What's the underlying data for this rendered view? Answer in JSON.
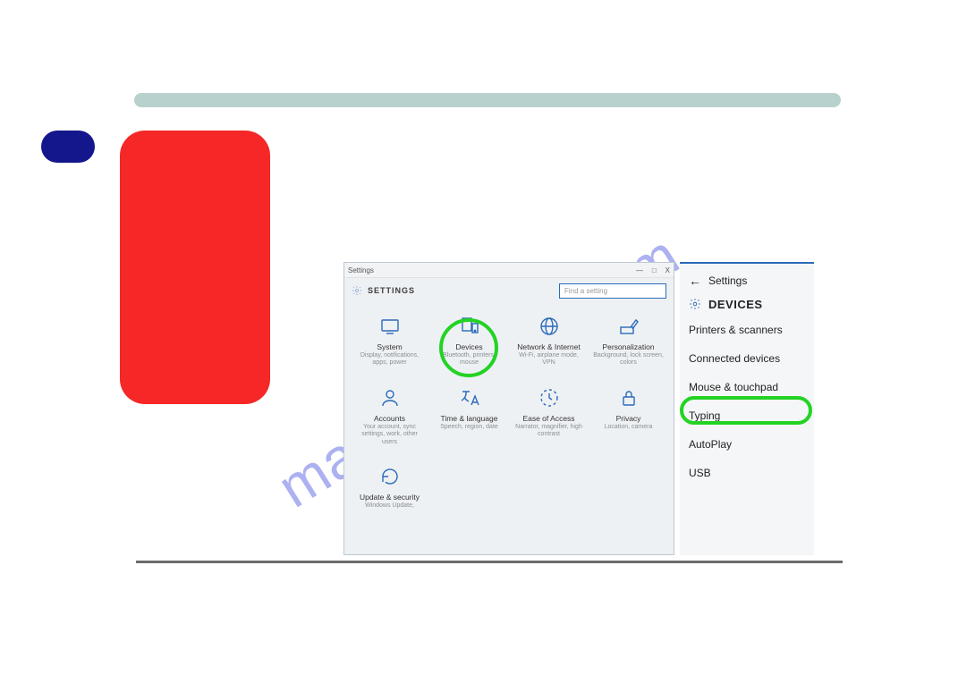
{
  "watermark": "manualshive.com",
  "settings_window": {
    "titlebar_label": "Settings",
    "header_title": "SETTINGS",
    "search_placeholder": "Find a setting",
    "tiles": [
      {
        "title": "System",
        "sub": "Display, notifications, apps, power"
      },
      {
        "title": "Devices",
        "sub": "Bluetooth, printers, mouse"
      },
      {
        "title": "Network & Internet",
        "sub": "Wi-Fi, airplane mode, VPN"
      },
      {
        "title": "Personalization",
        "sub": "Background, lock screen, colors"
      },
      {
        "title": "Accounts",
        "sub": "Your account, sync settings, work, other users"
      },
      {
        "title": "Time & language",
        "sub": "Speech, region, date"
      },
      {
        "title": "Ease of Access",
        "sub": "Narrator, magnifier, high contrast"
      },
      {
        "title": "Privacy",
        "sub": "Location, camera"
      },
      {
        "title": "Update & security",
        "sub": "Windows Update,"
      }
    ]
  },
  "side_panel": {
    "back_label": "Settings",
    "section_title": "DEVICES",
    "items": [
      "Printers & scanners",
      "Connected devices",
      "Mouse & touchpad",
      "Typing",
      "AutoPlay",
      "USB"
    ]
  },
  "window_controls": {
    "min": "—",
    "max": "□",
    "close": "X"
  }
}
